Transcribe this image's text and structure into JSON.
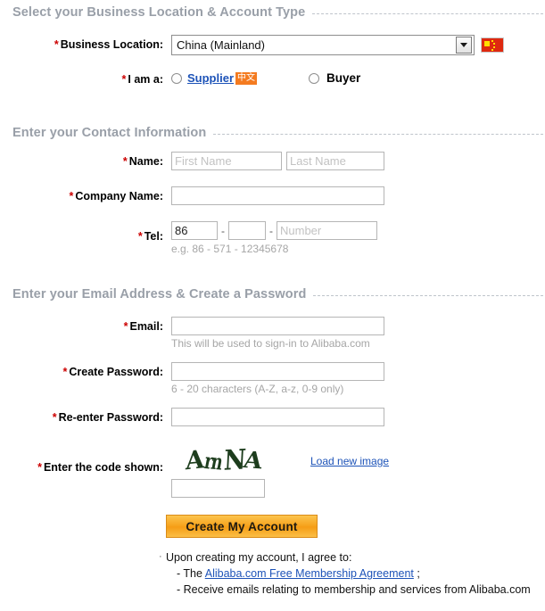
{
  "sections": {
    "location": {
      "title": "Select your Business Location & Account Type"
    },
    "contact": {
      "title": "Enter your Contact Information"
    },
    "account": {
      "title": "Enter your Email Address & Create a Password"
    }
  },
  "business_location": {
    "label": "Business Location:",
    "required_mark": "*",
    "selected": "China (Mainland)",
    "flag_icon": "china-flag-icon",
    "caret_icon": "chevron-down-icon"
  },
  "i_am_a": {
    "label": "I am a:",
    "required_mark": "*",
    "supplier": {
      "text": "Supplier",
      "badge": "中文"
    },
    "buyer": {
      "text": "Buyer"
    }
  },
  "name_field": {
    "label": "Name:",
    "required_mark": "*",
    "first_placeholder": "First Name",
    "last_placeholder": "Last Name",
    "first_value": "",
    "last_value": ""
  },
  "company_field": {
    "label": "Company Name:",
    "required_mark": "*",
    "value": ""
  },
  "tel_field": {
    "label": "Tel:",
    "required_mark": "*",
    "country_code": "86",
    "area_code": "",
    "number_placeholder": "Number",
    "number_value": "",
    "separator": "-",
    "hint": "e.g. 86  -   571   - 12345678"
  },
  "email_field": {
    "label": "Email:",
    "required_mark": "*",
    "value": "",
    "hint": "This will be used to sign-in to Alibaba.com"
  },
  "password_field": {
    "label": "Create Password:",
    "required_mark": "*",
    "value": "",
    "hint": "6 - 20 characters (A-Z, a-z, 0-9 only)"
  },
  "repassword_field": {
    "label": "Re-enter Password:",
    "required_mark": "*",
    "value": ""
  },
  "captcha": {
    "label": "Enter the code shown:",
    "required_mark": "*",
    "code_text": "ArnNA",
    "reload_link": "Load new image",
    "input_value": ""
  },
  "submit": {
    "label": "Create My Account"
  },
  "terms": {
    "intro": "Upon creating my account, I agree to:",
    "line2_prefix": "- The ",
    "line2_link": "Alibaba.com Free Membership Agreement",
    "line2_suffix": " ;",
    "line3": "- Receive emails relating to membership and services from Alibaba.com"
  },
  "colors": {
    "section_header": "#999fa8",
    "required_star": "#cc0000",
    "link": "#1d53b8",
    "badge_orange": "#f47b20",
    "button_orange": "#f6a019",
    "flag_red": "#de2910",
    "captcha_green": "#1d3d1d",
    "placeholder": "#c2c2c2",
    "hint_gray": "#a6a6a6"
  }
}
